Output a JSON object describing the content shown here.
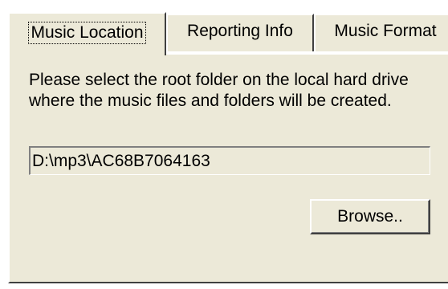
{
  "tabs": [
    {
      "label": "Music Location",
      "active": true
    },
    {
      "label": "Reporting Info",
      "active": false
    },
    {
      "label": "Music Format",
      "active": false
    }
  ],
  "panel": {
    "description": "Please select the root folder on the local hard drive where the music files and folders will be created.",
    "path_value": "D:\\mp3\\AC68B7064163",
    "browse_label": "Browse.."
  }
}
